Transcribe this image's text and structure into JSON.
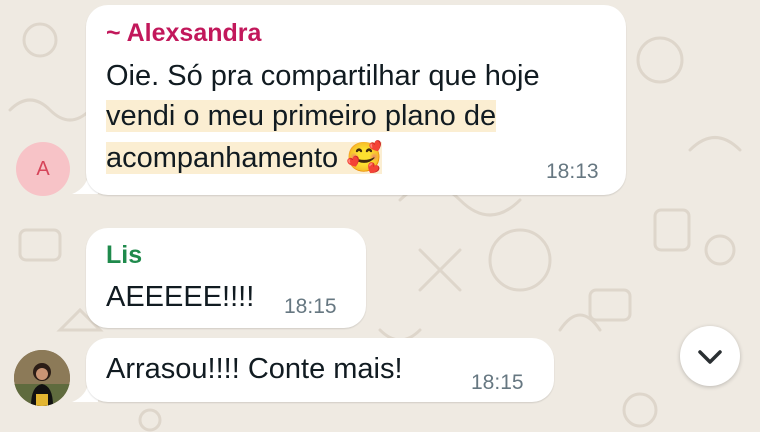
{
  "colors": {
    "chat_background": "#efeae2",
    "bubble_background": "#ffffff",
    "sender_alexsandra": "#c2185b",
    "sender_lis": "#1f8a4c",
    "highlight": "#fbeed2",
    "timestamp": "#667781",
    "avatar_a_bg": "#f7c3c7",
    "avatar_a_text": "#d6455a"
  },
  "messages": [
    {
      "sender": "~ Alexsandra",
      "avatar_initial": "A",
      "line1": "Oie. Só pra compartilhar que hoje",
      "line2": "vendi o meu primeiro plano de",
      "line3": "acompanhamento 🥰",
      "time": "18:13"
    },
    {
      "sender": "Lis",
      "text": "AEEEEE!!!!",
      "time": "18:15"
    },
    {
      "text": "Arrasou!!!! Conte mais!",
      "time": "18:15"
    }
  ],
  "scroll_button": {
    "icon": "chevron-down-icon"
  }
}
